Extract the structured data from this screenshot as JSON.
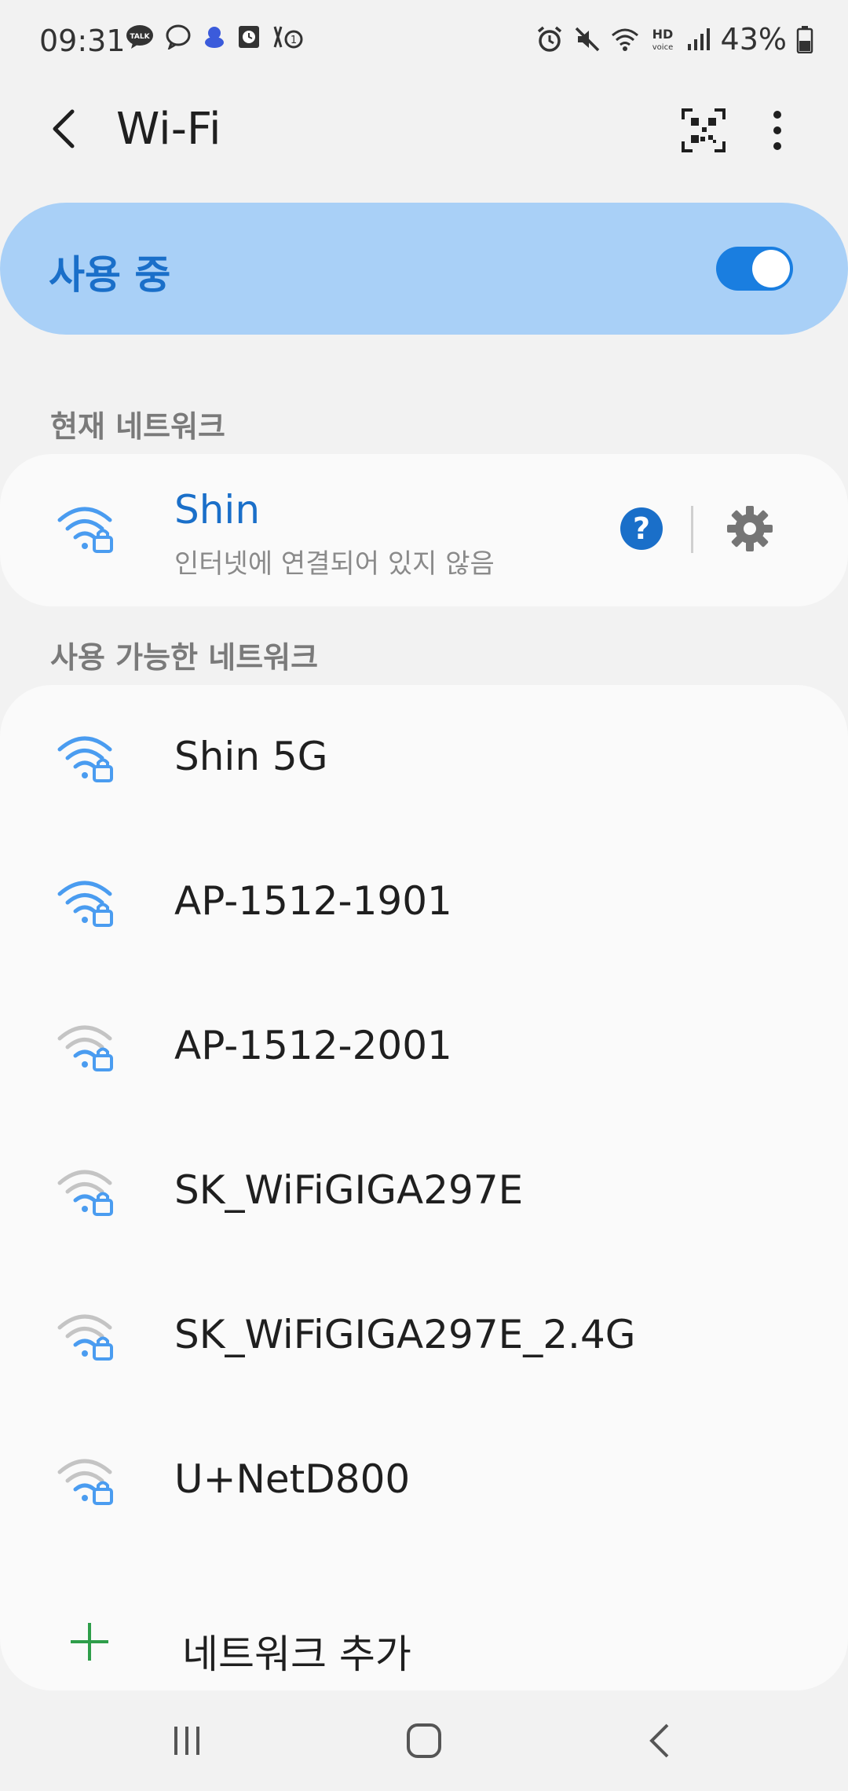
{
  "status_bar": {
    "time": "09:31",
    "left_icons": [
      "kakaotalk-icon",
      "chat-bubble-icon",
      "app-notification-icon",
      "clock-app-icon",
      "call-sim-icon"
    ],
    "right_icons": [
      "alarm-icon",
      "mute-icon",
      "wifi-status-icon",
      "hd-voice-icon",
      "signal-icon",
      "battery-icon"
    ],
    "battery_percent": "43%"
  },
  "header": {
    "title": "Wi-Fi",
    "back_icon": "back-arrow-icon",
    "qr_icon": "qr-scan-icon",
    "more_icon": "more-vert-icon"
  },
  "master_switch": {
    "label": "사용 중",
    "on": true
  },
  "current_section": {
    "header": "현재 네트워크",
    "network": {
      "name": "Shin",
      "status": "인터넷에 연결되어 있지 않음",
      "help_label": "?"
    }
  },
  "available_section": {
    "header": "사용 가능한 네트워크",
    "networks": [
      {
        "name": "Shin 5G",
        "strong": true
      },
      {
        "name": "AP-1512-1901",
        "strong": true
      },
      {
        "name": "AP-1512-2001",
        "strong": false
      },
      {
        "name": "SK_WiFiGIGA297E",
        "strong": false
      },
      {
        "name": "SK_WiFiGIGA297E_2.4G",
        "strong": false
      },
      {
        "name": "U+NetD800",
        "strong": false
      }
    ],
    "add_label": "네트워크 추가"
  },
  "colors": {
    "accent": "#1a6fc9",
    "master_bg": "#a9d0f7",
    "add_green": "#2e9e4a",
    "wifi_strong": "#4a9cf0",
    "wifi_weak": "#c4c4c4"
  },
  "nav_bar": {
    "recents_icon": "recents-icon",
    "home_icon": "home-icon",
    "back_icon": "nav-back-icon"
  }
}
